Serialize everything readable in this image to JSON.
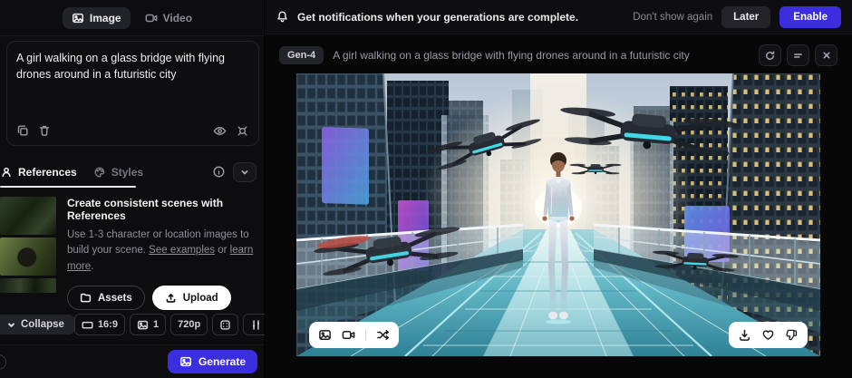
{
  "colors": {
    "accent": "#3b2ee0",
    "panel_bg": "#0d0d0f",
    "canvas_bg": "#070708",
    "pill_bg": "#ffffff"
  },
  "left_panel": {
    "mode_tabs": {
      "image": "Image",
      "video": "Video"
    },
    "prompt": {
      "text": "A girl walking on a glass bridge with flying drones around in a futuristic city"
    },
    "panel_tabs": {
      "references": "References",
      "styles": "Styles"
    },
    "references_section": {
      "title": "Create consistent scenes with References",
      "body_a": "Use 1-3 character or location images to build your scene.",
      "link_examples": "See examples",
      "body_b": "or",
      "link_learn": "learn more",
      "period": ".",
      "assets_button": "Assets",
      "upload_button": "Upload"
    },
    "settings_bar": {
      "collapse": "Collapse",
      "aspect_ratio": "16:9",
      "image_count": "1",
      "resolution": "720p"
    },
    "generate_button": "Generate"
  },
  "notification_bar": {
    "message": "Get notifications when your generations are complete.",
    "dismiss": "Don't show again",
    "later": "Later",
    "enable": "Enable"
  },
  "generation": {
    "model_badge": "Gen-4",
    "prompt": "A girl walking on a glass bridge with flying drones around in a futuristic city",
    "image_alt": "Generated image: a girl in a silver jumpsuit walking on a glass bridge between futuristic skyscrapers with flying drones around her"
  }
}
